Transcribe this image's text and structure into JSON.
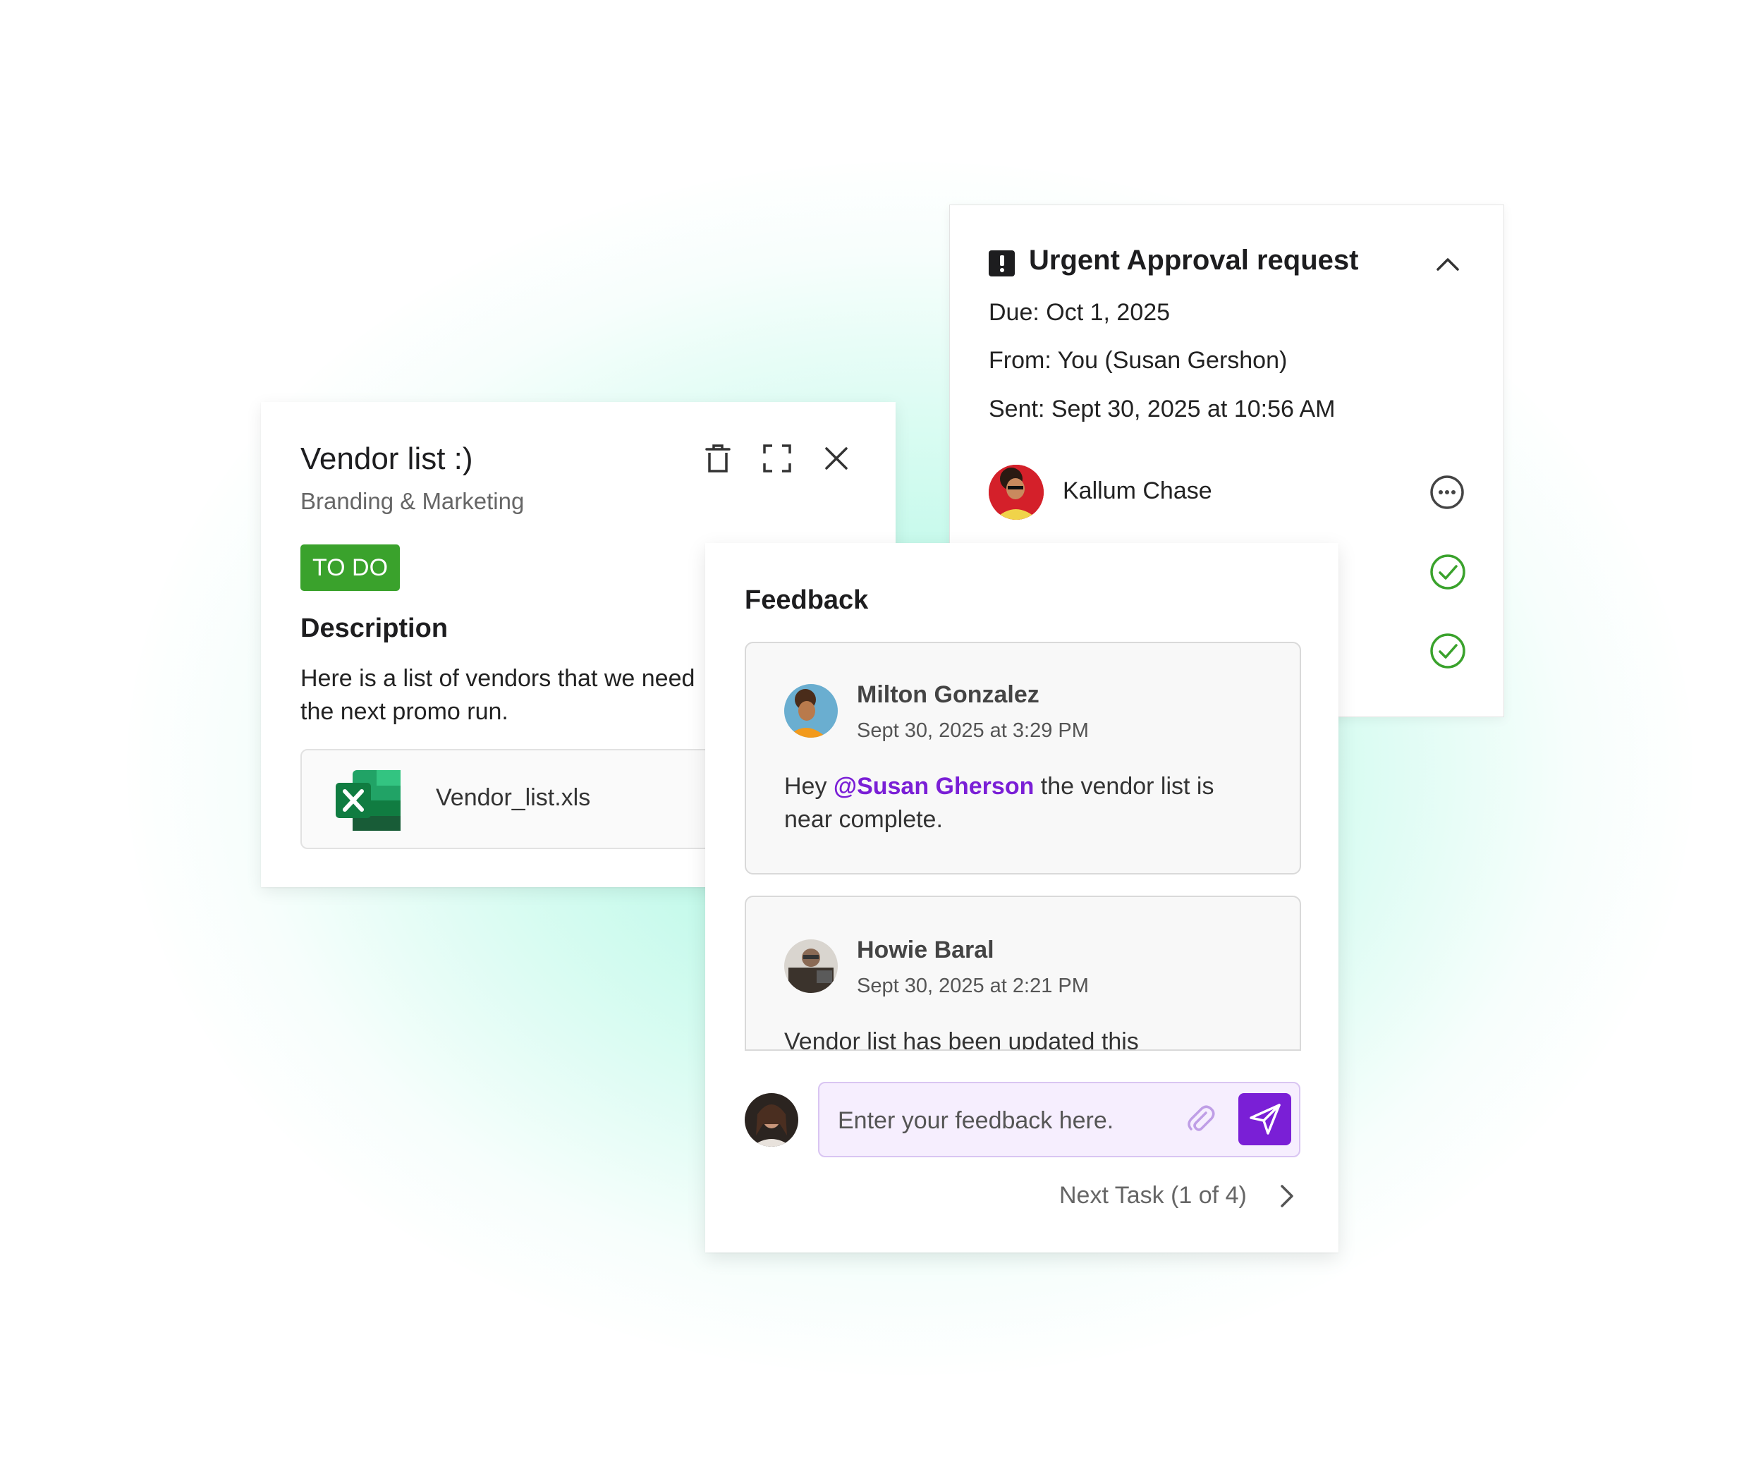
{
  "approval": {
    "title": "Urgent Approval request",
    "due": "Due: Oct 1, 2025",
    "from": "From: You (Susan Gershon)",
    "sent": "Sent:  Sept 30, 2025 at 10:56 AM",
    "approver_name": "Kallum Chase",
    "approver_status": "pending",
    "other_statuses": [
      "approved",
      "approved"
    ]
  },
  "vendor": {
    "title": "Vendor list :)",
    "subtitle": "Branding & Marketing",
    "status": "TO DO",
    "description_heading": "Description",
    "description_line1": "Here is a list of vendors that we need",
    "description_line2": "the next promo run.",
    "attachment": "Vendor_list.xls"
  },
  "feedback": {
    "heading": "Feedback",
    "comments": [
      {
        "name": "Milton Gonzalez",
        "time": "Sept 30, 2025 at 3:29 PM",
        "text_prefix": "Hey ",
        "mention": "@Susan Gherson",
        "text_suffix": " the vendor list is",
        "text_line2": "near complete."
      },
      {
        "name": "Howie Baral",
        "time": "Sept 30, 2025 at 2:21 PM",
        "text": "Vendor list has been updated this"
      }
    ],
    "input_placeholder": "Enter your feedback here.",
    "next_task": "Next Task (1 of 4)"
  },
  "colors": {
    "status_green": "#3aa22c",
    "accent_purple": "#7a1fd6",
    "approved_green": "#3aa22c",
    "glow": "#5cf0c8"
  },
  "icons": [
    "alert-icon",
    "chevron-up-icon",
    "more-options-icon",
    "check-circle-icon",
    "trash-icon",
    "expand-icon",
    "close-icon",
    "excel-file-icon",
    "attach-icon",
    "send-icon",
    "chevron-right-icon"
  ]
}
